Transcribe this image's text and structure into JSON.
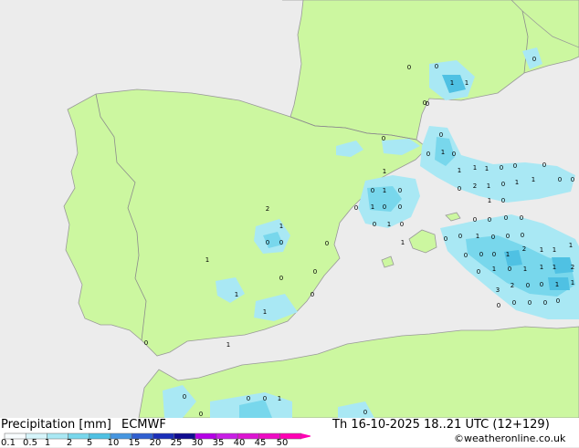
{
  "map": {
    "region_colors": {
      "land": "#ccf7a0",
      "sea": "#ececec",
      "coast": "#999999",
      "border": "#8c8c8c"
    },
    "precip_cells": [
      {
        "label": "0",
        "v": 0.1
      },
      {
        "label": "0",
        "v": 0.1
      },
      {
        "label": "1",
        "v": 1
      },
      {
        "label": "1",
        "v": 1
      },
      {
        "label": "0",
        "v": 0.1
      },
      {
        "label": "0",
        "v": 0.1
      },
      {
        "label": "0",
        "v": 0.1
      },
      {
        "label": "0",
        "v": 0.1
      },
      {
        "label": "1",
        "v": 1
      },
      {
        "label": "0",
        "v": 0.1
      },
      {
        "label": "1",
        "v": 1
      },
      {
        "label": "1",
        "v": 1
      },
      {
        "label": "1",
        "v": 1
      },
      {
        "label": "0",
        "v": 0.1
      },
      {
        "label": "0",
        "v": 0.1
      },
      {
        "label": "0",
        "v": 0.1
      },
      {
        "label": "1",
        "v": 1
      },
      {
        "label": "0",
        "v": 0.1
      },
      {
        "label": "1",
        "v": 1
      },
      {
        "label": "0",
        "v": 0.1
      },
      {
        "label": "1",
        "v": 1
      },
      {
        "label": "0",
        "v": 0.1
      },
      {
        "label": "0",
        "v": 0.1
      },
      {
        "label": "0",
        "v": 0.1
      },
      {
        "label": "0",
        "v": 0.1
      },
      {
        "label": "2",
        "v": 2
      },
      {
        "label": "1",
        "v": 1
      },
      {
        "label": "0",
        "v": 0.1
      },
      {
        "label": "1",
        "v": 1
      },
      {
        "label": "1",
        "v": 1
      },
      {
        "label": "0",
        "v": 0.1
      },
      {
        "label": "0",
        "v": 0.1
      },
      {
        "label": "1",
        "v": 1
      },
      {
        "label": "0",
        "v": 0.1
      },
      {
        "label": "0",
        "v": 0.1
      },
      {
        "label": "1",
        "v": 1
      },
      {
        "label": "0",
        "v": 0.1
      },
      {
        "label": "2",
        "v": 2
      },
      {
        "label": "1",
        "v": 1
      },
      {
        "label": "0",
        "v": 0.1
      },
      {
        "label": "0",
        "v": 0.1
      },
      {
        "label": "0",
        "v": 0.1
      },
      {
        "label": "1",
        "v": 1
      },
      {
        "label": "0",
        "v": 0.1
      },
      {
        "label": "0",
        "v": 0.1
      },
      {
        "label": "0",
        "v": 0.1
      },
      {
        "label": "0",
        "v": 0.1
      },
      {
        "label": "0",
        "v": 0.1
      },
      {
        "label": "0",
        "v": 0.1
      },
      {
        "label": "1",
        "v": 1
      },
      {
        "label": "0",
        "v": 0.1
      },
      {
        "label": "0",
        "v": 0.1
      },
      {
        "label": "0",
        "v": 0.1
      },
      {
        "label": "0",
        "v": 0.1
      },
      {
        "label": "0",
        "v": 0.1
      },
      {
        "label": "1",
        "v": 1
      },
      {
        "label": "2",
        "v": 2
      },
      {
        "label": "1",
        "v": 1
      },
      {
        "label": "1",
        "v": 1
      },
      {
        "label": "1",
        "v": 1
      },
      {
        "label": "0",
        "v": 0.1
      },
      {
        "label": "0",
        "v": 0.1
      },
      {
        "label": "1",
        "v": 1
      },
      {
        "label": "0",
        "v": 0.1
      },
      {
        "label": "1",
        "v": 1
      },
      {
        "label": "1",
        "v": 1
      },
      {
        "label": "1",
        "v": 1
      },
      {
        "label": "2",
        "v": 2
      },
      {
        "label": "1",
        "v": 1
      },
      {
        "label": "0",
        "v": 0.1
      },
      {
        "label": "1",
        "v": 1
      },
      {
        "label": "0",
        "v": 0.1
      },
      {
        "label": "1",
        "v": 1
      },
      {
        "label": "3",
        "v": 3
      },
      {
        "label": "2",
        "v": 2
      },
      {
        "label": "0",
        "v": 0.1
      },
      {
        "label": "0",
        "v": 0.1
      },
      {
        "label": "1",
        "v": 1
      },
      {
        "label": "1",
        "v": 1
      },
      {
        "label": "0",
        "v": 0.1
      },
      {
        "label": "0",
        "v": 0.1
      },
      {
        "label": "0",
        "v": 0.1
      },
      {
        "label": "0",
        "v": 0.1
      },
      {
        "label": "0",
        "v": 0.1
      },
      {
        "label": "0",
        "v": 0.1
      },
      {
        "label": "0",
        "v": 0.1
      },
      {
        "label": "0",
        "v": 0.1
      },
      {
        "label": "1",
        "v": 1
      },
      {
        "label": "0",
        "v": 0.1
      },
      {
        "label": "0",
        "v": 0.1
      },
      {
        "label": "0",
        "v": 0.1
      },
      {
        "label": "1",
        "v": 1
      },
      {
        "label": "0",
        "v": 0.1
      },
      {
        "label": "0",
        "v": 0.1
      },
      {
        "label": "0",
        "v": 0.1
      }
    ]
  },
  "legend": {
    "title": "Precipitation [mm]",
    "model": "ECMWF",
    "scale_labels": [
      "0.1",
      "0.5",
      "1",
      "2",
      "5",
      "10",
      "15",
      "20",
      "25",
      "30",
      "35",
      "40",
      "45",
      "50"
    ],
    "scale_colors": [
      "#f8fdff",
      "#d6f5fb",
      "#a9e8f4",
      "#78d7ec",
      "#4fc1e3",
      "#4696e0",
      "#2f5fd0",
      "#1a2eb8",
      "#100c90",
      "#b400e6",
      "#c81ee6",
      "#dc14d2",
      "#ee0ac4",
      "#ff00b4"
    ]
  },
  "valid_time": "Th 16-10-2025 18..21 UTC (12+129)",
  "credit": "©weatheronline.co.uk"
}
